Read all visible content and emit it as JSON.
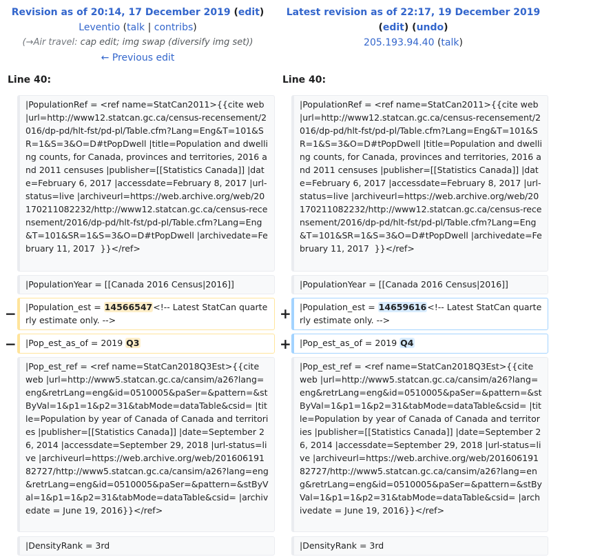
{
  "left_header": {
    "title": "Revision as of 20:14, 17 December 2019",
    "edit_link": "edit",
    "user": "Leventio",
    "talk": "talk",
    "contribs": "contribs",
    "comment_section": "→Air travel:",
    "comment_text": "cap edit; img swap (diversify img set)",
    "prev_edit": "← Previous edit"
  },
  "right_header": {
    "title": "Latest revision as of 22:17, 19 December 2019",
    "edit_link": "edit",
    "undo_link": "undo",
    "user": "205.193.94.40",
    "talk": "talk"
  },
  "line_label": "Line 40:",
  "markers": {
    "minus": "−",
    "plus": "+"
  },
  "context": {
    "population_ref": "|PopulationRef = <ref name=StatCan2011>{{cite web |url=http://www12.statcan.gc.ca/census-recensement/2016/dp-pd/hlt-fst/pd-pl/Table.cfm?Lang=Eng&T=101&SR=1&S=3&O=D#tPopDwell |title=Population and dwelling counts, for Canada, provinces and territories, 2016 and 2011 censuses |publisher=[[Statistics Canada]] |date=February 6, 2017 |accessdate=February 8, 2017 |url-status=live |archiveurl=https://web.archive.org/web/20170211082232/http://www12.statcan.gc.ca/census-recensement/2016/dp-pd/hlt-fst/pd-pl/Table.cfm?Lang=Eng&T=101&SR=1&S=3&O=D#tPopDwell |archivedate=February 11, 2017  }}</ref>",
    "population_year": "|PopulationYear = [[Canada 2016 Census|2016]]",
    "pop_est_ref": "|Pop_est_ref = <ref name=StatCan2018Q3Est>{{cite web |url=http://www5.statcan.gc.ca/cansim/a26?lang=eng&retrLang=eng&id=0510005&paSer=&pattern=&stByVal=1&p1=1&p2=31&tabMode=dataTable&csid= |title=Population by year of Canada of Canada and territories |publisher=[[Statistics Canada]] |date=September 26, 2014 |accessdate=September 29, 2018 |url-status=live |archiveurl=https://web.archive.org/web/20160619182727/http://www5.statcan.gc.ca/cansim/a26?lang=eng&retrLang=eng&id=0510005&paSer=&pattern=&stByVal=1&p1=1&p2=31&tabMode=dataTable&csid= |archivedate = June 19, 2016}}</ref>",
    "density_rank": "|DensityRank = 3rd"
  },
  "deleted": {
    "pop_est_prefix": "|Population_est = ",
    "pop_est_value": "14566547",
    "pop_est_suffix": "<!-- Latest StatCan quarterly estimate only. -->",
    "as_of_prefix": "|Pop_est_as_of = 2019 ",
    "as_of_value": "Q3"
  },
  "added": {
    "pop_est_prefix": "|Population_est = ",
    "pop_est_value": "14659616",
    "pop_est_suffix": "<!-- Latest StatCan quarterly estimate only. -->",
    "as_of_prefix": "|Pop_est_as_of = 2019 ",
    "as_of_value": "Q4"
  },
  "colors": {
    "link": "#3366cc",
    "deleted_border": "#ffe49c",
    "deleted_highlight": "#feeec8",
    "added_border": "#a3d3ff",
    "added_highlight": "#d8ecff",
    "context_bg": "#f8f9fa"
  }
}
